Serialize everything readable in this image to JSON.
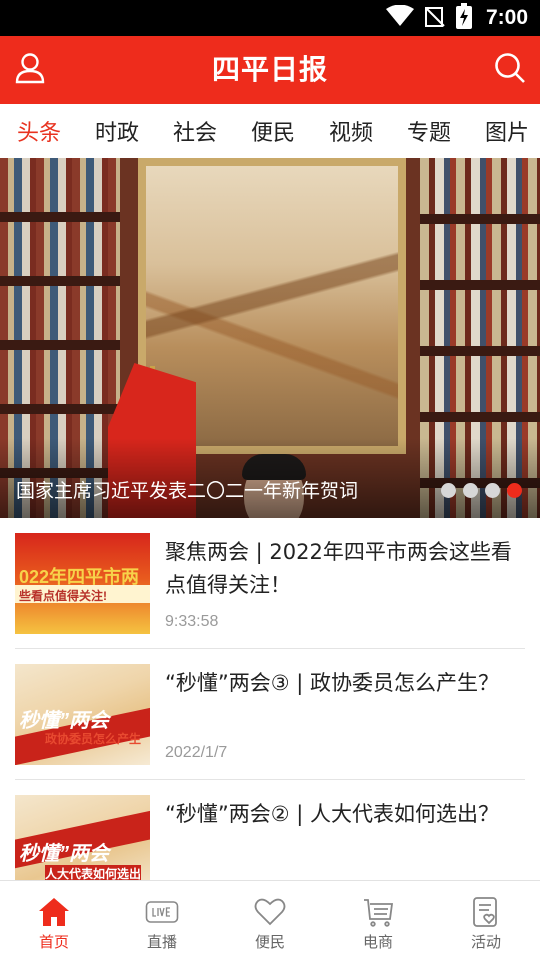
{
  "status_bar": {
    "time": "7:00",
    "icons": [
      "wifi-icon",
      "no-signal-icon",
      "battery-charging-icon"
    ]
  },
  "header": {
    "title": "四平日报",
    "left_icon": "user-icon",
    "right_icon": "search-icon",
    "background_color": "#ee2c1c"
  },
  "tabs": [
    {
      "label": "头条",
      "active": true
    },
    {
      "label": "时政",
      "active": false
    },
    {
      "label": "社会",
      "active": false
    },
    {
      "label": "便民",
      "active": false
    },
    {
      "label": "视频",
      "active": false
    },
    {
      "label": "专题",
      "active": false
    },
    {
      "label": "图片",
      "active": false
    }
  ],
  "banner": {
    "caption": "国家主席习近平发表二〇二一年新年贺词",
    "slide_count": 4,
    "active_slide": 4
  },
  "news": [
    {
      "title": "聚焦两会 | 2022年四平市两会这些看点值得关注！",
      "time": "9:33:58",
      "thumb_text_main": "022年四平市两",
      "thumb_text_sub": "些看点值得关注!"
    },
    {
      "title": "“秒懂”两会③ | 政协委员怎么产生？",
      "time": "2022/1/7",
      "thumb_text_main": "秒懂”两会",
      "thumb_text_sub": "政协委员怎么产生"
    },
    {
      "title": "“秒懂”两会② | 人大代表如何选出？",
      "time": "",
      "thumb_text_main": "秒懂”两会",
      "thumb_text_sub": "人大代表如何选出"
    }
  ],
  "bottom_nav": [
    {
      "label": "首页",
      "icon": "home-icon",
      "active": true
    },
    {
      "label": "直播",
      "icon": "live-icon",
      "active": false
    },
    {
      "label": "便民",
      "icon": "heart-icon",
      "active": false
    },
    {
      "label": "电商",
      "icon": "cart-icon",
      "active": false
    },
    {
      "label": "活动",
      "icon": "activity-icon",
      "active": false
    }
  ],
  "colors": {
    "accent": "#ee2c1c",
    "active_tab_text": "#e8321f",
    "muted_text": "#9a9a9a"
  }
}
